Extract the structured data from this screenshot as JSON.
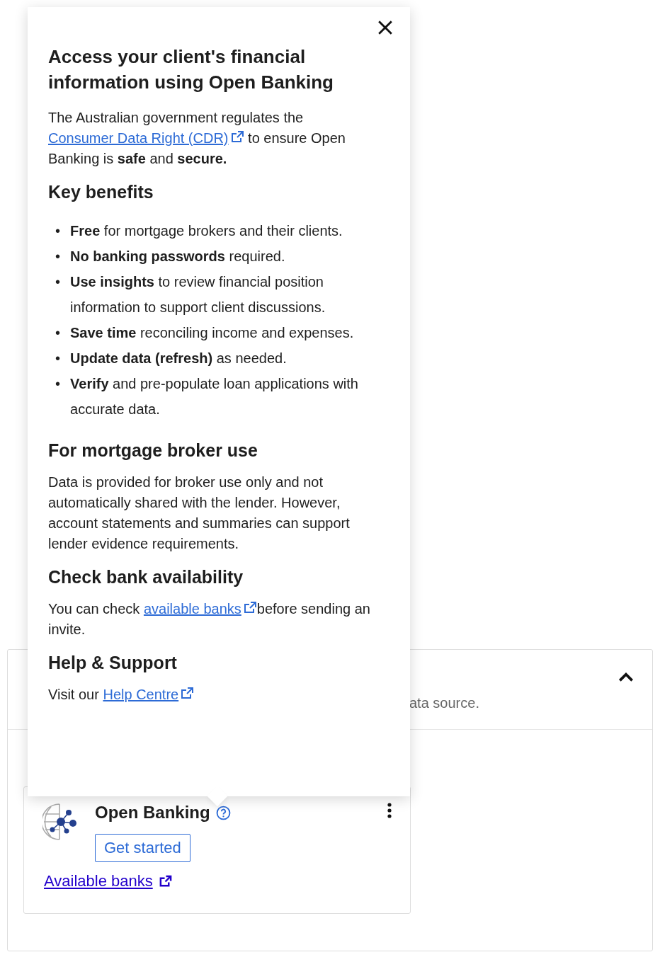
{
  "popover": {
    "title": "Access your client's financial information using Open Banking",
    "intro": {
      "before": "The Australian government regulates the",
      "link": "Consumer Data Right (CDR)",
      "after": "to ensure Open Banking is **safe** and **secure.**"
    },
    "sections": [
      {
        "heading": "Key benefits",
        "kind": "list",
        "items": [
          {
            "marker": "•",
            "text": "**Free** for mortgage brokers and their clients."
          },
          {
            "marker": "•",
            "text": "**No banking passwords** required."
          },
          {
            "marker": "•",
            "text": "**Use insights** to review financial position information to support client discussions."
          },
          {
            "marker": "•",
            "text": "**Save time** reconciling income and expenses."
          },
          {
            "marker": "•",
            "text": "**Update data (refresh)** as needed."
          },
          {
            "marker": "•",
            "text": "**Verify** and pre-populate loan applications with accurate data."
          }
        ]
      },
      {
        "heading": "For mortgage broker use",
        "kind": "text",
        "text": "Data is provided for broker use only and not automatically shared with the lender. However, account statements and summaries can support lender evidence requirements."
      },
      {
        "heading": "Check bank availability",
        "kind": "link",
        "before": "You can check",
        "link": "available banks",
        "after": "before sending an invite."
      },
      {
        "heading": "Help & Support",
        "kind": "link",
        "before": "Visit our",
        "link": "Help Centre"
      }
    ]
  },
  "panel": {
    "description": "ata source.",
    "expanded": true,
    "card": {
      "title": "Open Banking",
      "button": "Get started",
      "link": "Available banks"
    }
  }
}
